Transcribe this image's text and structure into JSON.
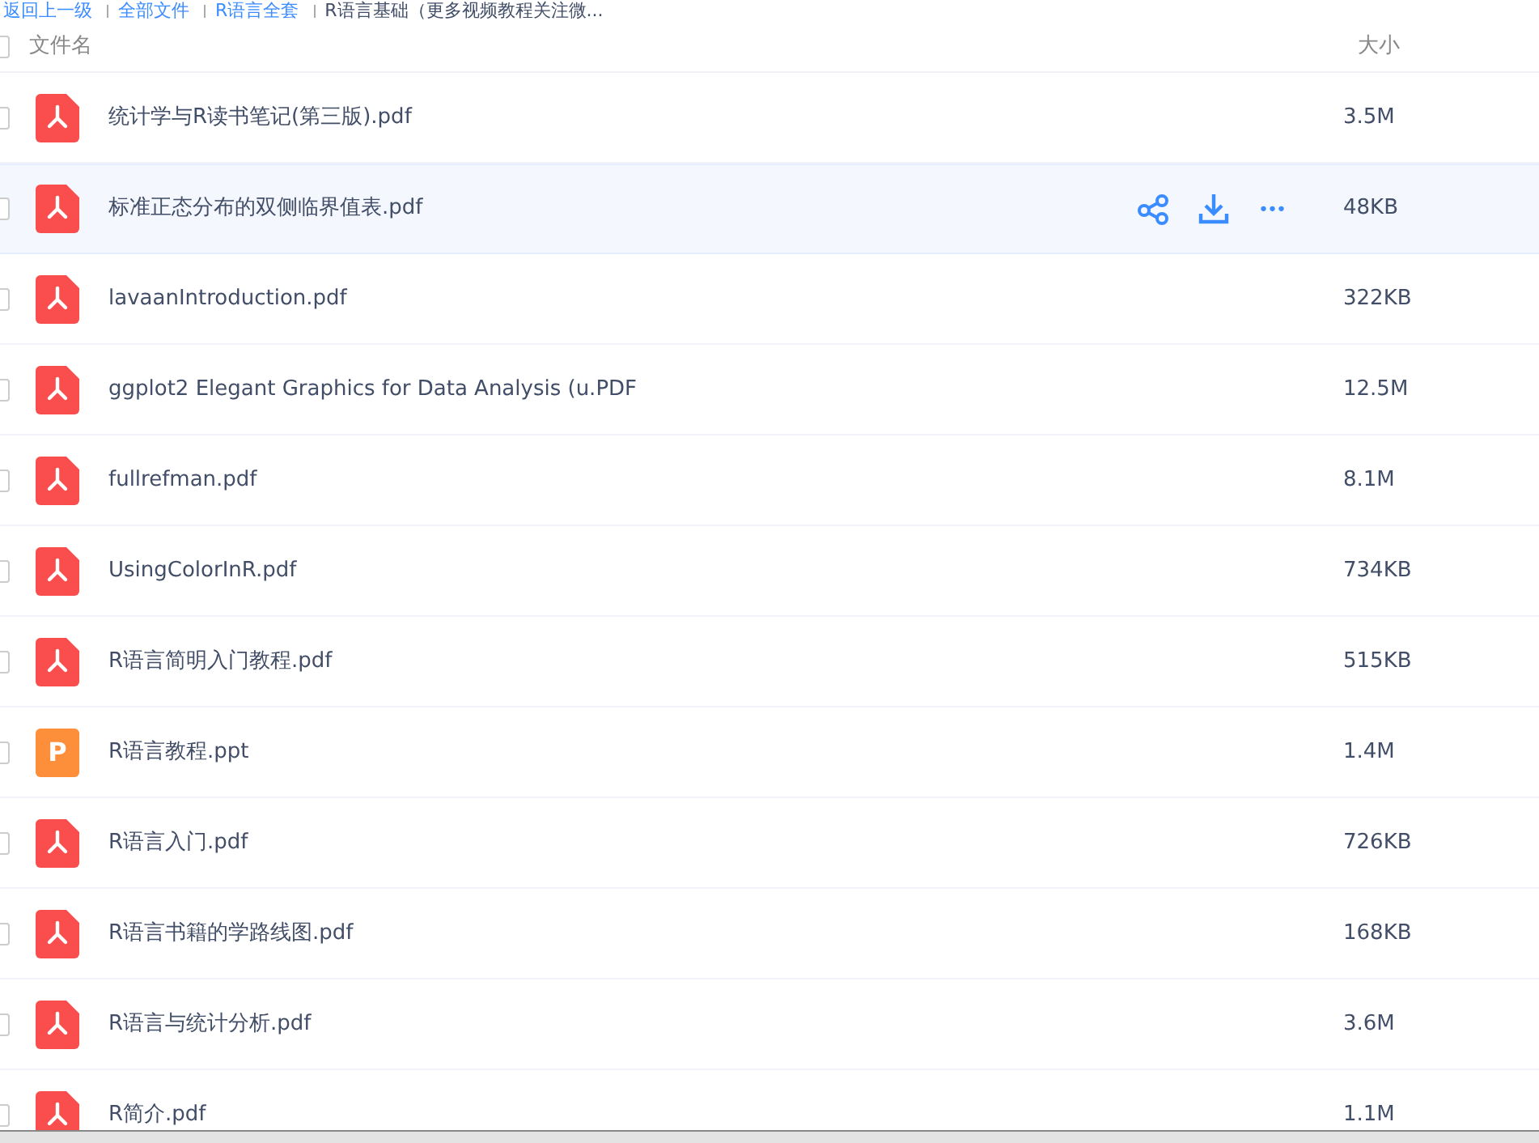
{
  "breadcrumb": [
    {
      "label": "返回上一级",
      "kind": "link"
    },
    {
      "label": "全部文件",
      "kind": "link"
    },
    {
      "label": "R语言全套",
      "kind": "link"
    },
    {
      "label": "R语言基础（更多视频教程关注微...",
      "kind": "current"
    }
  ],
  "table": {
    "select_all_checked": false,
    "columns": [
      "文件名",
      "大小"
    ],
    "rows": [
      {
        "name": "统计学与R读书笔记(第三版).pdf",
        "size": "3.5M",
        "kind": "pdf",
        "hovered": false,
        "checked": false
      },
      {
        "name": "标准正态分布的双侧临界值表.pdf",
        "size": "48KB",
        "kind": "pdf",
        "hovered": true,
        "checked": false
      },
      {
        "name": "lavaanIntroduction.pdf",
        "size": "322KB",
        "kind": "pdf",
        "hovered": false,
        "checked": false
      },
      {
        "name": "ggplot2 Elegant Graphics for Data Analysis (u.PDF",
        "size": "12.5M",
        "kind": "pdf",
        "hovered": false,
        "checked": false
      },
      {
        "name": "fullrefman.pdf",
        "size": "8.1M",
        "kind": "pdf",
        "hovered": false,
        "checked": false
      },
      {
        "name": "UsingColorInR.pdf",
        "size": "734KB",
        "kind": "pdf",
        "hovered": false,
        "checked": false
      },
      {
        "name": "R语言简明入门教程.pdf",
        "size": "515KB",
        "kind": "pdf",
        "hovered": false,
        "checked": false
      },
      {
        "name": "R语言教程.ppt",
        "size": "1.4M",
        "kind": "ppt",
        "ppt_letter": "P",
        "hovered": false,
        "checked": false
      },
      {
        "name": "R语言入门.pdf",
        "size": "726KB",
        "kind": "pdf",
        "hovered": false,
        "checked": false
      },
      {
        "name": "R语言书籍的学路线图.pdf",
        "size": "168KB",
        "kind": "pdf",
        "hovered": false,
        "checked": false
      },
      {
        "name": "R语言与统计分析.pdf",
        "size": "3.6M",
        "kind": "pdf",
        "hovered": false,
        "checked": false
      },
      {
        "name": "R简介.pdf",
        "size": "1.1M",
        "kind": "pdf",
        "hovered": false,
        "checked": false
      }
    ]
  },
  "more_icon_glyph": "•••"
}
